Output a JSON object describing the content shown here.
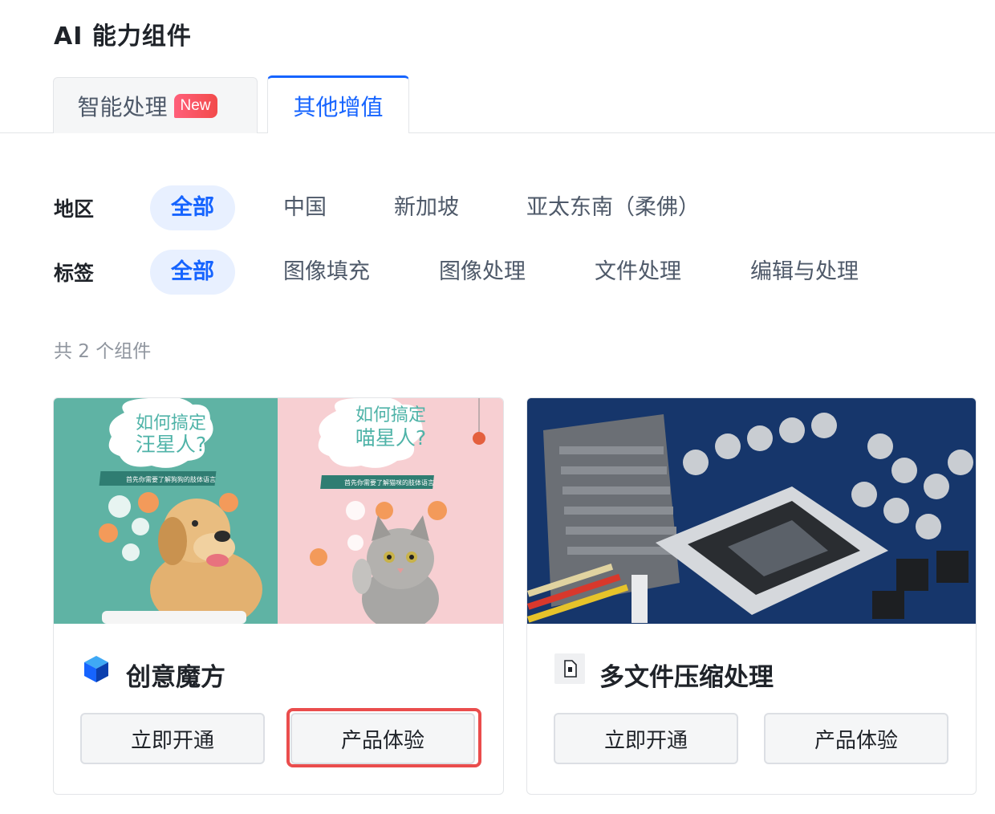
{
  "page": {
    "title": "AI 能力组件"
  },
  "tabs": [
    {
      "label": "智能处理",
      "badge": "New",
      "active": false
    },
    {
      "label": "其他增值",
      "active": true
    }
  ],
  "filters": {
    "region": {
      "label": "地区",
      "options": [
        "全部",
        "中国",
        "新加坡",
        "亚太东南（柔佛）"
      ],
      "selected": "全部"
    },
    "tags": {
      "label": "标签",
      "options": [
        "全部",
        "图像填充",
        "图像处理",
        "文件处理",
        "编辑与处理"
      ],
      "selected": "全部"
    }
  },
  "summary": {
    "count_text": "共 2 个组件"
  },
  "cards": [
    {
      "name": "创意魔方",
      "icon": "cube-icon",
      "image": {
        "left_title_1": "如何搞定",
        "left_title_2": "汪星人?",
        "left_subtitle": "首先你需要了解狗狗的肢体语言",
        "right_title_1": "如何搞定",
        "right_title_2": "喵星人?",
        "right_subtitle": "首先你需要了解猫咪的肢体语言"
      },
      "buttons": {
        "primary": "立即开通",
        "secondary": "产品体验"
      },
      "highlighted_button": "产品体验"
    },
    {
      "name": "多文件压缩处理",
      "icon": "zip-file-icon",
      "image": {
        "subject": "circuit-board"
      },
      "buttons": {
        "primary": "立即开通",
        "secondary": "产品体验"
      }
    }
  ],
  "colors": {
    "accent": "#1664ff",
    "active_chip_bg": "#e8f0ff",
    "badge": "#f24b4b",
    "highlight": "#ea4d4d"
  }
}
